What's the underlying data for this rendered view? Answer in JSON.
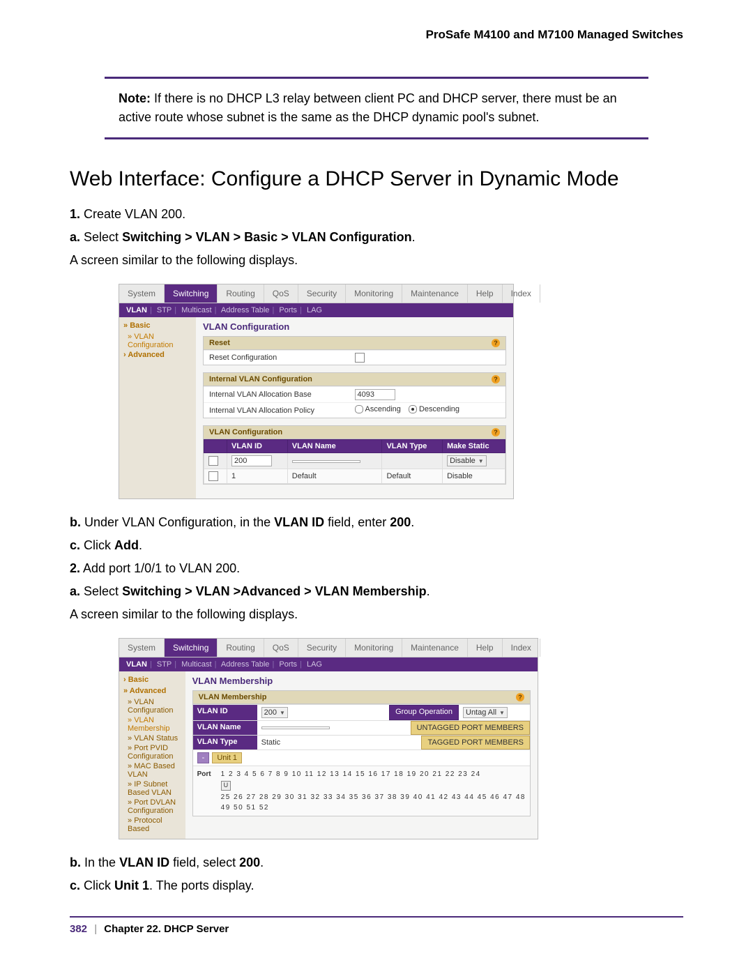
{
  "productHeader": "ProSafe M4100 and M7100 Managed Switches",
  "note": {
    "label": "Note:",
    "body": "If there is no DHCP L3 relay between client PC and DHCP server, there must be an active route whose subnet is the same as the DHCP dynamic pool's subnet."
  },
  "sectionTitle": "Web Interface: Configure a DHCP Server in Dynamic Mode",
  "steps": {
    "s1_num": "1.",
    "s1_text": "Create VLAN 200.",
    "s1a_num": "a.",
    "s1a_prefix": "Select ",
    "s1a_bold": "Switching > VLAN > Basic > VLAN Configuration",
    "s1a_plain": "A screen similar to the following displays.",
    "s1b_num": "b.",
    "s1b_pre": "Under VLAN Configuration, in the ",
    "s1b_b1": "VLAN ID",
    "s1b_mid": " field, enter ",
    "s1b_b2": "200",
    "s1c_num": "c.",
    "s1c_pre": "Click ",
    "s1c_bold": "Add",
    "s2_num": "2.",
    "s2_text": "Add port 1/0/1 to VLAN 200.",
    "s2a_num": "a.",
    "s2a_prefix": "Select ",
    "s2a_bold": "Switching > VLAN >Advanced > VLAN Membership",
    "s2a_plain": "A screen similar to the following displays.",
    "s2b_num": "b.",
    "s2b_pre": "In the ",
    "s2b_b1": "VLAN ID",
    "s2b_mid": " field, select ",
    "s2b_b2": "200",
    "s2c_num": "c.",
    "s2c_pre": "Click ",
    "s2c_bold": "Unit 1",
    "s2c_post": ". The ports display."
  },
  "shot1": {
    "tabs": [
      "System",
      "Switching",
      "Routing",
      "QoS",
      "Security",
      "Monitoring",
      "Maintenance",
      "Help",
      "Index"
    ],
    "activeTab": "Switching",
    "subtabs": [
      "VLAN",
      "STP",
      "Multicast",
      "Address Table",
      "Ports",
      "LAG"
    ],
    "activeSub": "VLAN",
    "sidebar": {
      "basic": "Basic",
      "vlanCfg": "VLAN Configuration",
      "advanced": "Advanced"
    },
    "panelTitle": "VLAN Configuration",
    "reset": {
      "header": "Reset",
      "row1": "Reset Configuration"
    },
    "internal": {
      "header": "Internal VLAN Configuration",
      "row1": "Internal VLAN Allocation Base",
      "val1": "4093",
      "row2": "Internal VLAN Allocation Policy",
      "asc": "Ascending",
      "desc": "Descending"
    },
    "vcfg": {
      "header": "VLAN Configuration",
      "h1": "VLAN ID",
      "h2": "VLAN Name",
      "h3": "VLAN Type",
      "h4": "Make Static",
      "r1_id": "200",
      "r1_make": "Disable",
      "r2_id": "1",
      "r2_name": "Default",
      "r2_type": "Default",
      "r2_make": "Disable"
    }
  },
  "shot2": {
    "tabs": [
      "System",
      "Switching",
      "Routing",
      "QoS",
      "Security",
      "Monitoring",
      "Maintenance",
      "Help",
      "Index"
    ],
    "activeTab": "Switching",
    "subtabs": [
      "VLAN",
      "STP",
      "Multicast",
      "Address Table",
      "Ports",
      "LAG"
    ],
    "activeSub": "VLAN",
    "sidebar": {
      "basic": "Basic",
      "advanced": "Advanced",
      "items": [
        "VLAN Configuration",
        "VLAN Membership",
        "VLAN Status",
        "Port PVID Configuration",
        "MAC Based VLAN",
        "IP Subnet Based VLAN",
        "Port DVLAN Configuration",
        "Protocol Based"
      ]
    },
    "panelTitle": "VLAN Membership",
    "boxHeader": "VLAN Membership",
    "rows": {
      "id": "VLAN ID",
      "idVal": "200",
      "groupOp": "Group Operation",
      "groupVal": "Untag All",
      "name": "VLAN Name",
      "untagged": "UNTAGGED PORT MEMBERS",
      "type": "VLAN Type",
      "typeVal": "Static",
      "tagged": "TAGGED PORT MEMBERS"
    },
    "unitDash": "-",
    "unitLabel": "Unit 1",
    "portLabel": "Port",
    "portU": "U",
    "ports1": "1  2  3  4  5  6  7  8  9  10 11 12 13 14 15 16 17 18 19 20 21 22 23 24",
    "ports2": "25 26 27 28 29 30 31 32 33 34 35 36 37 38 39 40 41 42 43 44 45 46 47 48",
    "ports3": "49 50 51 52"
  },
  "footer": {
    "page": "382",
    "chapter": "Chapter 22.  DHCP Server"
  }
}
